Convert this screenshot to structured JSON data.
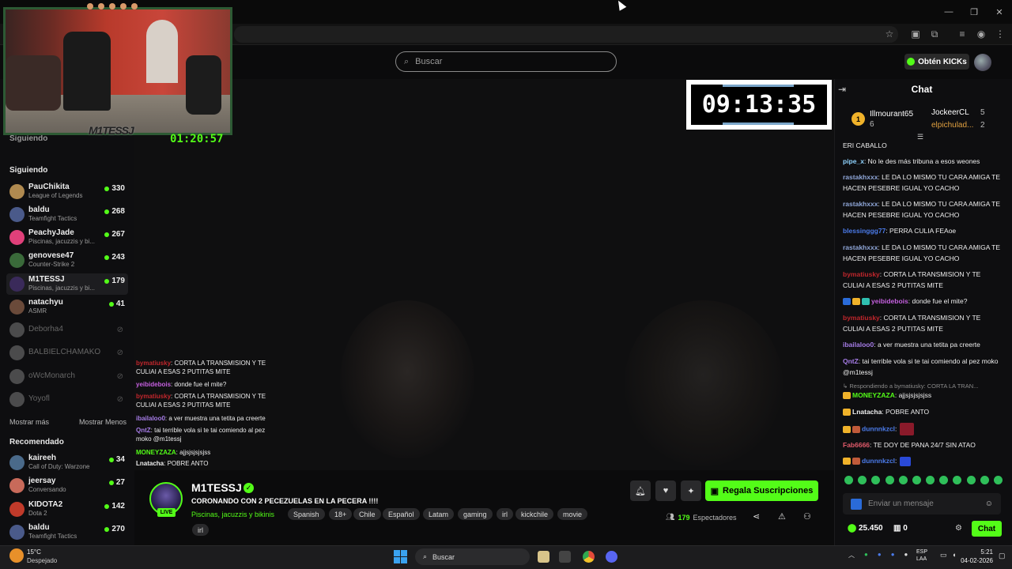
{
  "search": {
    "placeholder": "Buscar"
  },
  "header": {
    "kicks_label": "Obtén KICKs"
  },
  "sidebar": {
    "following_collapsed": "Siguiendo",
    "following_title": "Siguiendo",
    "following": [
      {
        "name": "PauChikita",
        "sub": "League of Legends",
        "count": "330"
      },
      {
        "name": "baldu",
        "sub": "Teamfight Tactics",
        "count": "268"
      },
      {
        "name": "PeachyJade",
        "sub": "Piscinas, jacuzzis y bi...",
        "count": "267"
      },
      {
        "name": "genovese47",
        "sub": "Counter-Strike 2",
        "count": "243"
      },
      {
        "name": "M1TESSJ",
        "sub": "Piscinas, jacuzzis y bi...",
        "count": "179"
      },
      {
        "name": "natachyu",
        "sub": "ASMR",
        "count": "41"
      }
    ],
    "offline": [
      "Deborha4",
      "BALBIELCHAMAKO",
      "oWcMonarch",
      "Yoyofl"
    ],
    "show_more": "Mostrar más",
    "show_less": "Mostrar Menos",
    "recommended_title": "Recomendado",
    "recommended": [
      {
        "name": "kaireeh",
        "sub": "Call of Duty: Warzone",
        "count": "34"
      },
      {
        "name": "jeersay",
        "sub": "Conversando",
        "count": "27"
      },
      {
        "name": "KIDOTA2",
        "sub": "Dota 2",
        "count": "142"
      },
      {
        "name": "baldu",
        "sub": "Teamfight Tactics",
        "count": "270"
      }
    ]
  },
  "webcam": {
    "overlay_name": "M1TESSJ",
    "timer": "01:20:57"
  },
  "video": {
    "clock": "09:13:35",
    "overlay_chat": [
      {
        "user": "bymatiusky",
        "text": ": CORTA LA TRANSMISION Y TE CULIAI A ESAS 2 PUTITAS MITE",
        "color": "#c0262c"
      },
      {
        "user": "yeibidebois",
        "text": ": donde fue el mite?",
        "color": "#c660e0"
      },
      {
        "user": "bymatiusky",
        "text": ": CORTA LA TRANSMISION Y TE CULIAI A ESAS 2 PUTITAS MITE",
        "color": "#c0262c"
      },
      {
        "user": "ibailaloo0",
        "text": ": a ver muestra una tetita pa creerte",
        "color": "#a77de8"
      },
      {
        "user": "QntZ",
        "text": ": tai terrible vola si te tai comiendo al pez moko @m1tessj",
        "color": "#a77de8"
      },
      {
        "user": "MONEYZAZA",
        "text": ": ajjsjsjsjsjss",
        "color": "#53fc18"
      },
      {
        "user": "Lnatacha",
        "text": ": POBRE ANTO",
        "color": "#eeeeee"
      }
    ]
  },
  "stream": {
    "live": "LIVE",
    "name": "M1TESSJ",
    "title": "CORONANDO CON 2 PECEZUELAS EN LA PECERA !!!!",
    "category": "Piscinas, jacuzzis y bikinis",
    "tags": [
      "Spanish",
      "18+",
      "Chile",
      "Español",
      "Latam",
      "gaming",
      "irl",
      "kickchile",
      "movie",
      "irl"
    ],
    "gift_label": "Regala Suscripciones",
    "viewers": "179",
    "viewers_label": "Espectadores"
  },
  "chat": {
    "title": "Chat",
    "leaders": [
      {
        "name": "Illmourant65",
        "count": "6"
      },
      {
        "name": "JockeerCL",
        "count": "5"
      },
      {
        "name": "elpichulad...",
        "count": "2"
      }
    ],
    "messages": [
      {
        "user": "",
        "text": "ERI CABALLO",
        "color": "#eeeeee"
      },
      {
        "user": "pipe_x",
        "text": ": No le des más tribuna a esos weones",
        "color": "#8fd3ff"
      },
      {
        "user": "rastakhxxx",
        "text": ": LE DA LO MISMO TU CARA AMIGA TE HACEN PESEBRE IGUAL YO CACHO",
        "color": "#8fa6d8"
      },
      {
        "user": "rastakhxxx",
        "text": ": LE DA LO MISMO TU CARA AMIGA TE HACEN PESEBRE IGUAL YO CACHO",
        "color": "#8fa6d8"
      },
      {
        "user": "blessinggg77",
        "text": ": PERRA CULIA FEAoe",
        "color": "#4b7bea"
      },
      {
        "user": "rastakhxxx",
        "text": ": LE DA LO MISMO TU CARA AMIGA TE HACEN PESEBRE IGUAL YO CACHO",
        "color": "#8fa6d8"
      },
      {
        "user": "bymatiusky",
        "text": ": CORTA LA TRANSMISION Y TE CULIAI A ESAS 2 PUTITAS MITE",
        "color": "#c0262c"
      },
      {
        "user": "yeibidebois",
        "text": ": donde fue el mite?",
        "color": "#c660e0"
      },
      {
        "user": "bymatiusky",
        "text": ": CORTA LA TRANSMISION Y TE CULIAI A ESAS 2 PUTITAS MITE",
        "color": "#c0262c"
      },
      {
        "user": "ibailaloo0",
        "text": ": a ver muestra una tetita pa creerte",
        "color": "#a77de8"
      },
      {
        "user": "QntZ",
        "text": ": tai terrible vola si te tai comiendo al pez moko @m1tessj",
        "color": "#a77de8"
      },
      {
        "user": "",
        "text": "Respondiendo a bymatiusky: CORTA LA TRAN...",
        "color": "#8a8a8a"
      },
      {
        "user": "MONEYZAZA",
        "text": ": ajjsjsjsjsjss",
        "color": "#53fc18"
      },
      {
        "user": "Lnatacha",
        "text": ": POBRE ANTO",
        "color": "#eeeeee"
      },
      {
        "user": "dunnnkzcl",
        "text": ":",
        "color": "#4b7bea"
      },
      {
        "user": "Fab6666",
        "text": ": TE DOY DE PANA 24/7 SIN ATAO",
        "color": "#e05a6a"
      },
      {
        "user": "dunnnkzcl",
        "text": ":",
        "color": "#4b7bea"
      }
    ],
    "input_placeholder": "Enviar un mensaje",
    "points": "25.450",
    "subs": "0",
    "send_label": "Chat"
  },
  "taskbar": {
    "temp": "15°C",
    "weather": "Despejado",
    "search": "Buscar",
    "lang1": "ESP",
    "lang2": "LAA",
    "time": "5:21",
    "date": "04-02-2026"
  }
}
